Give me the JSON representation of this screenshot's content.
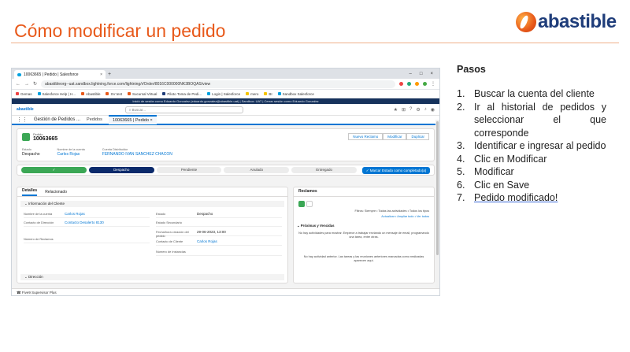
{
  "slide": {
    "title": "Cómo modificar un pedido",
    "logo_text": "abastible"
  },
  "browser": {
    "tab_title": "10063665 | Pedido | Salesforce",
    "url": "abastibleorg--uat.sandbox.lightning.force.com/lightning/r/Order/8016C000000NK3BOQAS/view",
    "bookmarks": [
      "Gemas",
      "Salesforce Help | H...",
      "Abastible",
      "SV test",
      "Sucursal Virtual",
      "Piloto Toma de Pedi...",
      "Login | Salesforce",
      "mero",
      "BI",
      "Sandbox Salesforce"
    ]
  },
  "salesforce": {
    "sandbox_banner": "Inició de sesión como Eduardo Gonzalez (eduardo.gonzalez@abastible.uat) | Sandbox: UAT | Cerrar sesión como Eduardo Gonzalez",
    "logo": "abastible",
    "search_placeholder": "Buscar...",
    "app_name": "Gestión de Pedidos ...",
    "nav_items": [
      "Pedidos"
    ],
    "workspace_tab": "10063665 | Pedido",
    "record": {
      "type": "Pedido",
      "name": "10063665",
      "actions": [
        "Nuevo Reclamo",
        "Modificar",
        "Duplicar"
      ],
      "highlight_fields": [
        {
          "label": "Estado",
          "value": "Despacho",
          "link": false
        },
        {
          "label": "Nombre de la cuenta",
          "value": "Carlos Rojas",
          "link": true
        },
        {
          "label": "Cuenta Distribuidor",
          "value": "FERNANDO IVAN SANCHEZ CHACON",
          "link": true
        }
      ]
    },
    "path": {
      "stages": [
        "✓",
        "Despacho",
        "Pendiente",
        "Anulado",
        "Entregado"
      ],
      "current_index": 1,
      "mark_button": "✓ Marcar Estado como completado(a)"
    },
    "detail": {
      "tabs": [
        "Detalles",
        "Relacionado"
      ],
      "section": "Información del Cliente",
      "fields": [
        {
          "label": "Nombre de la cuenta",
          "value": "Carlos Rojas",
          "link": true
        },
        {
          "label": "Estado",
          "value": "Despacho",
          "link": false
        },
        {
          "label": "Contacto de Dirección",
          "value": "Contacto Desalerto 8130",
          "link": true
        },
        {
          "label": "Estado Secundario",
          "value": "",
          "link": false
        },
        {
          "label": "Fecha/hora creación del pedido",
          "value": "29-06-2023, 13:00",
          "link": false
        },
        {
          "label": "Número de Reclamos",
          "value": "",
          "link": false
        },
        {
          "label": "Contacto de Cliente",
          "value": "Carlos Rojas",
          "link": true
        },
        {
          "label": "Número de Instancias",
          "value": "",
          "link": false
        }
      ],
      "section2": "Dirección"
    },
    "reclamos": {
      "title": "Reclamos",
      "filter_text": "Filtros: Siempre • Todas las actividades • Todos los tipos",
      "links": "Actualizar • Ampliar todo • Ver todos",
      "upcoming": "Próximas y Vencidas",
      "no_activity": "No hay actividades para mostrar. Empiece a trabajar enviando un mensaje de email, programando una tarea, entre otras.",
      "past": "No hay actividad anterior. Las tareas y las reuniones anteriores marcadas como realizadas aparecen aquí."
    },
    "utility_bar": "Five9 Supervisor Plus"
  },
  "steps": {
    "heading": "Pasos",
    "items": [
      {
        "num": "1.",
        "text": "Buscar la cuenta del cliente"
      },
      {
        "num": "2.",
        "text": "Ir al historial de pedidos y seleccionar el que corresponde"
      },
      {
        "num": "3.",
        "text": "Identificar e ingresar al pedido"
      },
      {
        "num": "4.",
        "text": "Clic en Modificar"
      },
      {
        "num": "5.",
        "text": "Modificar"
      },
      {
        "num": "6.",
        "text": "Clic en Save"
      },
      {
        "num": "7.",
        "text": "Pedido modificado!"
      }
    ]
  }
}
